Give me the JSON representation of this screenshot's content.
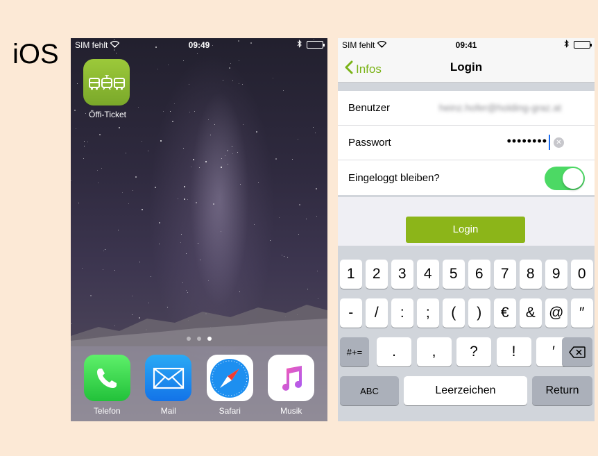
{
  "platform_label": "iOS",
  "home": {
    "status": {
      "carrier": "SIM fehlt",
      "time": "09:49"
    },
    "app": {
      "label": "Öffi-Ticket",
      "icon": "train-bus-tram-icon",
      "color": "#8bbb33"
    },
    "page_count": 3,
    "active_page": 3,
    "dock": [
      {
        "label": "Telefon",
        "icon": "phone-icon"
      },
      {
        "label": "Mail",
        "icon": "mail-icon"
      },
      {
        "label": "Safari",
        "icon": "safari-compass-icon"
      },
      {
        "label": "Musik",
        "icon": "music-note-icon"
      }
    ]
  },
  "login": {
    "status": {
      "carrier": "SIM fehlt",
      "time": "09:41"
    },
    "nav": {
      "back_label": "Infos",
      "title": "Login"
    },
    "fields": {
      "user_label": "Benutzer",
      "user_value": "heinz.hofer@holding-graz.at",
      "password_label": "Passwort",
      "password_value": "••••••••",
      "stay_logged_in_label": "Eingeloggt bleiben?",
      "stay_logged_in": true
    },
    "login_button": "Login",
    "accent_color": "#8cb519",
    "keyboard": {
      "row1": [
        "1",
        "2",
        "3",
        "4",
        "5",
        "6",
        "7",
        "8",
        "9",
        "0"
      ],
      "row2": [
        "-",
        "/",
        ":",
        ";",
        "(",
        ")",
        "€",
        "&",
        "@",
        "″"
      ],
      "row3": {
        "shift": "#+=",
        "keys": [
          ".",
          ",",
          "?",
          "!",
          "′"
        ],
        "delete": "delete-icon"
      },
      "row4": {
        "abc": "ABC",
        "space": "Leerzeichen",
        "return": "Return"
      }
    }
  }
}
